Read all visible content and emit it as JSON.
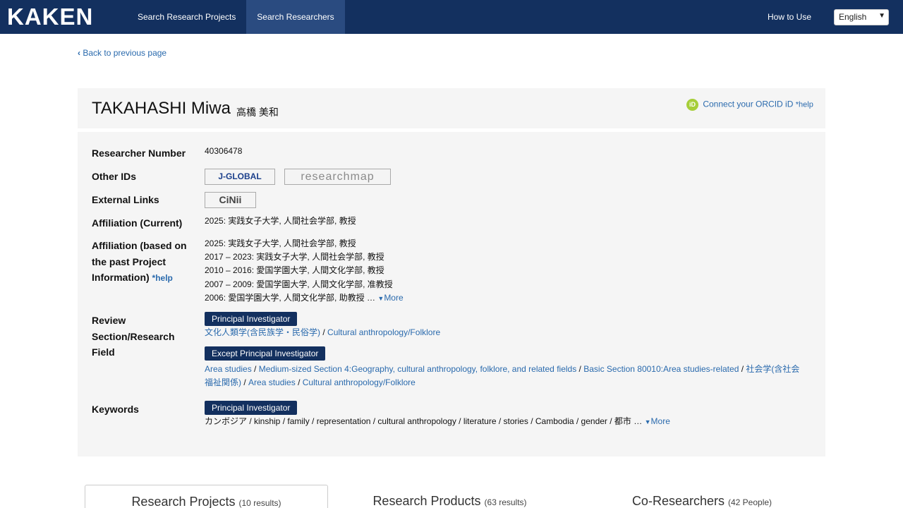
{
  "header": {
    "logo": "KAKEN",
    "nav": [
      "Search Research Projects",
      "Search Researchers"
    ],
    "how_to_use": "How to Use",
    "language": "English"
  },
  "back_link": "Back to previous page",
  "researcher": {
    "name_en": "TAKAHASHI Miwa",
    "name_ja": "高橋 美和",
    "orcid_link": "Connect your ORCID iD",
    "orcid_help": "*help"
  },
  "labels": {
    "researcher_number": "Researcher Number",
    "other_ids": "Other IDs",
    "external_links": "External Links",
    "affiliation_current": "Affiliation (Current)",
    "affiliation_past_1": "Affiliation (based on",
    "affiliation_past_2": "the past Project",
    "affiliation_past_3": "Information)",
    "affiliation_help": "*help",
    "review_1": "Review",
    "review_2": "Section/Research",
    "review_3": "Field",
    "keywords": "Keywords"
  },
  "researcher_number": "40306478",
  "other_ids": [
    "J-GLOBAL",
    "researchmap"
  ],
  "external_links": [
    "CiNii"
  ],
  "affiliation_current": "2025: 実践女子大学, 人間社会学部, 教授",
  "affiliation_past": [
    "2025: 実践女子大学, 人間社会学部, 教授",
    "2017 – 2023: 実践女子大学, 人間社会学部, 教授",
    "2010 – 2016: 愛国学園大学, 人間文化学部, 教授",
    "2007 – 2009: 愛国学園大学, 人間文化学部, 准教授",
    "2006: 愛国学園大学, 人間文化学部, 助教授 …"
  ],
  "more_label": "More",
  "review": {
    "pi_badge": "Principal Investigator",
    "pi_fields": [
      "文化人類学(含民族学・民俗学)",
      "Cultural anthropology/Folklore"
    ],
    "except_badge": "Except Principal Investigator",
    "except_fields_line1": [
      "Area studies",
      "Medium-sized Section 4:Geography, cultural anthropology, folklore, and related fields",
      "Basic Section 80010:Area studies-related",
      "社会学(含社会"
    ],
    "except_fields_line2": [
      "福祉関係)",
      "Area studies",
      "Cultural anthropology/Folklore"
    ]
  },
  "keywords": {
    "badge": "Principal Investigator",
    "text": "カンボジア / kinship / family / representation / cultural anthropology / literature / stories / Cambodia / gender / 都市 …"
  },
  "tabs": [
    {
      "label": "Research Projects",
      "count": "(10 results)"
    },
    {
      "label": "Research Products",
      "count": "(63 results)"
    },
    {
      "label": "Co-Researchers",
      "count": "(42 People)"
    }
  ]
}
